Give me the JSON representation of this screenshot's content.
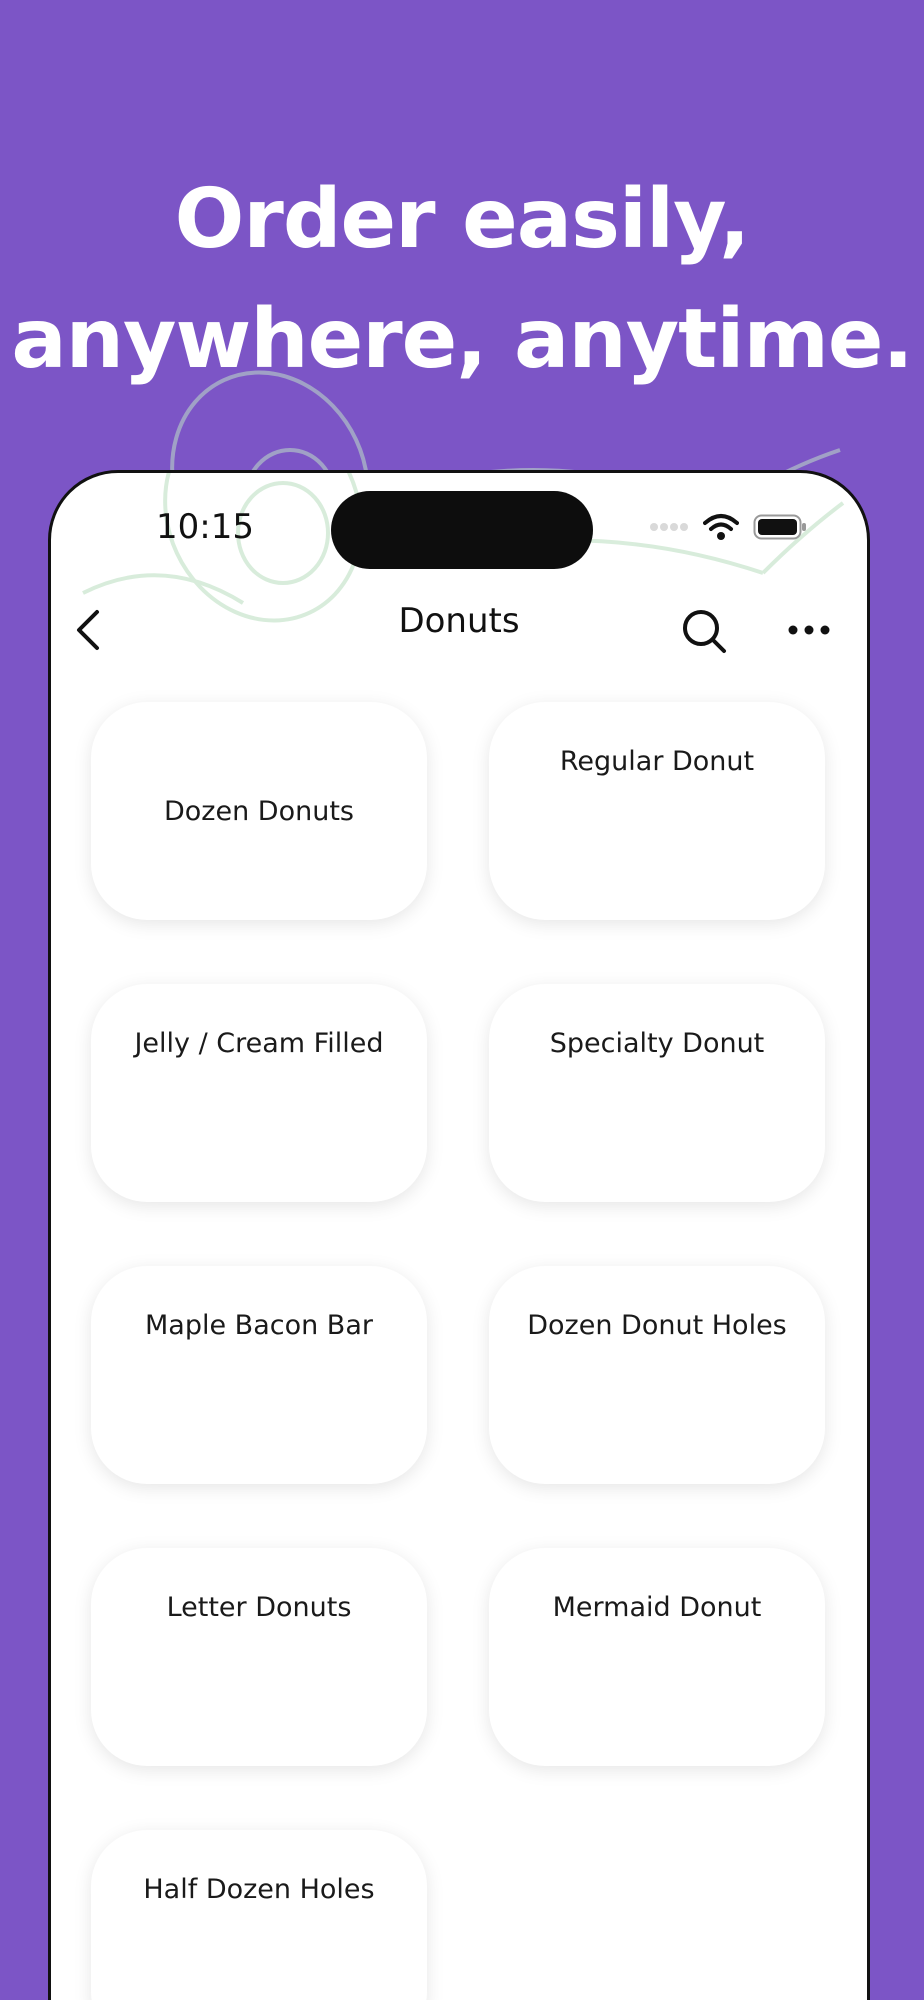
{
  "headline": {
    "line1": "Order easily,",
    "line2": "anywhere, anytime."
  },
  "status_bar": {
    "time": "10:15"
  },
  "nav": {
    "title": "Donuts",
    "back_icon": "chevron-left-icon",
    "search_icon": "search-icon",
    "more_icon": "more-horizontal-icon"
  },
  "items": [
    {
      "label": "Dozen Donuts"
    },
    {
      "label": "Regular Donut"
    },
    {
      "label": "Jelly / Cream Filled"
    },
    {
      "label": "Specialty Donut"
    },
    {
      "label": "Maple Bacon Bar"
    },
    {
      "label": "Dozen Donut Holes"
    },
    {
      "label": "Letter Donuts"
    },
    {
      "label": "Mermaid Donut"
    },
    {
      "label": "Half Dozen Holes"
    }
  ],
  "colors": {
    "background": "#7C55C6",
    "card": "#ffffff",
    "text": "#1a1a1a"
  }
}
